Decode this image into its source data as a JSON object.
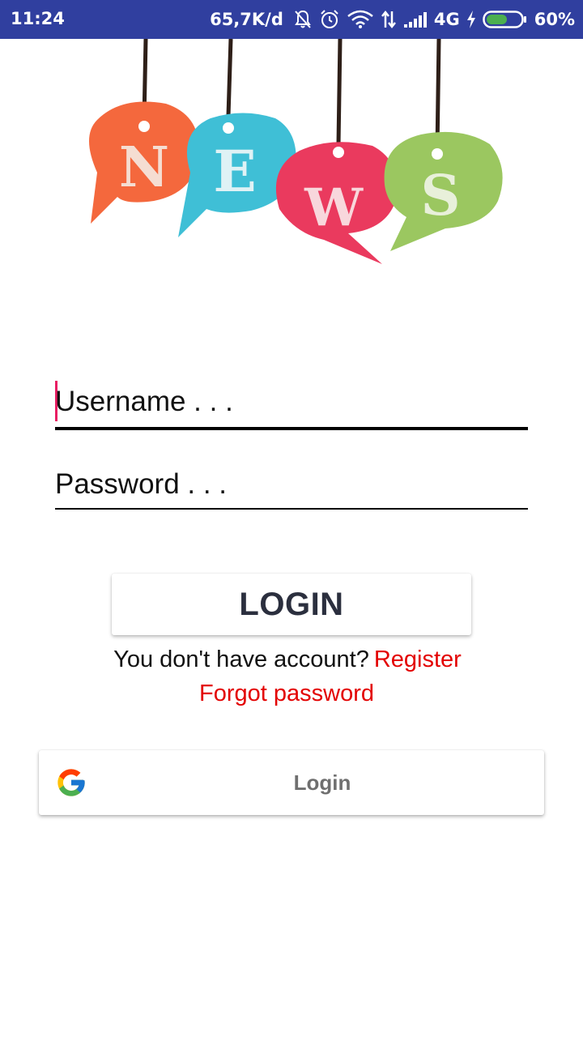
{
  "status_bar": {
    "time": "11:24",
    "net_speed": "65,7K/d",
    "network": "4G",
    "battery": "60%",
    "battery_level": 0.6,
    "icons": [
      "notifications-off-icon",
      "alarm-icon",
      "wifi-icon",
      "data-transfer-icon",
      "signal-icon",
      "charging-icon",
      "battery-icon"
    ]
  },
  "logo": {
    "letters": [
      "N",
      "E",
      "W",
      "S"
    ],
    "bubble_colors": [
      "#f4683d",
      "#3fbfd6",
      "#ea3a5e",
      "#9bc760"
    ]
  },
  "form": {
    "username_placeholder": "Username . . .",
    "password_placeholder": "Password . . .",
    "login_label": "LOGIN",
    "no_account_text": "You don't have account?",
    "register_label": "Register",
    "forgot_label": "Forgot password"
  },
  "google": {
    "login_label": "Login",
    "icon": "google-icon"
  },
  "colors": {
    "status_bar": "#303f9f",
    "link": "#e30000",
    "cursor": "#e91e63",
    "button_text": "#2b2f3e"
  }
}
